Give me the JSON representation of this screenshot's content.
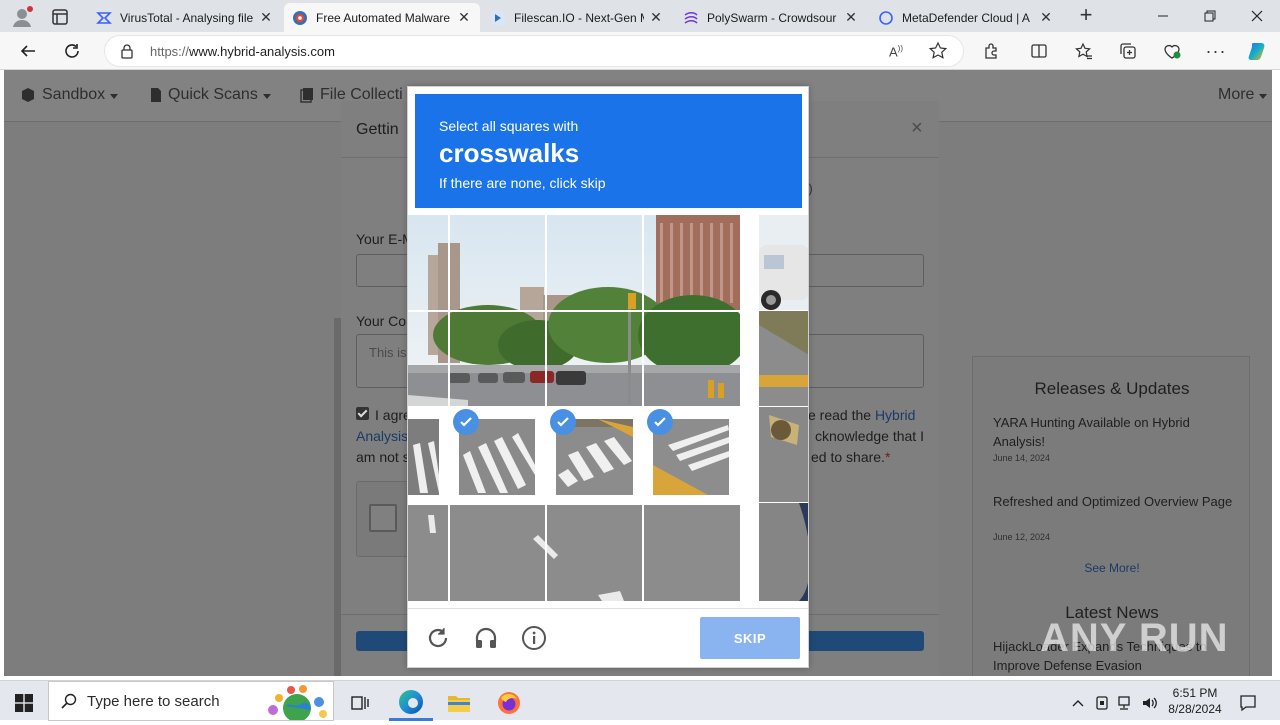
{
  "browser": {
    "tabs": [
      {
        "title": "VirusTotal - Analysing file",
        "icon": "virustotal-icon"
      },
      {
        "title": "Free Automated Malware",
        "icon": "hybrid-analysis-icon",
        "active": true
      },
      {
        "title": "Filescan.IO - Next-Gen M",
        "icon": "filescan-icon"
      },
      {
        "title": "PolySwarm - Crowdsour",
        "icon": "polyswarm-icon"
      },
      {
        "title": "MetaDefender Cloud | A",
        "icon": "loading-icon"
      }
    ],
    "url": {
      "scheme": "https://",
      "host": "www.hybrid-analysis.com"
    }
  },
  "site": {
    "nav": {
      "sandbox": "Sandbox",
      "quick_scans": "Quick Scans",
      "file_collections": "File Collecti",
      "more": "More"
    },
    "side": {
      "releases_heading": "Releases & Updates",
      "items": [
        {
          "title": "YARA Hunting Available on Hybrid Analysis!",
          "date": "June 14, 2024"
        },
        {
          "title": "Refreshed and Optimized Overview Page",
          "date": "June 12, 2024"
        }
      ],
      "see_more": "See More!",
      "news_heading": "Latest News",
      "news_item": "HijackLoader Expands Techniques to Improve Defense Evasion"
    }
  },
  "modal": {
    "title": "Gettin",
    "sub_fragment": "(ID)",
    "email_label": "Your E-M",
    "comment_label": "Your Co",
    "comment_placeholder": "This is",
    "agree_line1_left": "I agre",
    "agree_line1_right": "e read the ",
    "agree_link1": "Hybrid",
    "agree_line2_link": "Analysis",
    "agree_line2_right": "cknowledge that I",
    "agree_line3_left": "am not s",
    "agree_line3_right": "ed to share.",
    "required_mark": "*"
  },
  "captcha": {
    "instruction": "Select all squares with",
    "target": "crosswalks",
    "note": "If there are none, click skip",
    "skip_label": "SKIP",
    "selected_tiles": [
      4,
      5,
      6
    ]
  },
  "watermark": "ANY RUN",
  "taskbar": {
    "search_placeholder": "Type here to search",
    "time": "6:51 PM",
    "date": "8/28/2024"
  }
}
